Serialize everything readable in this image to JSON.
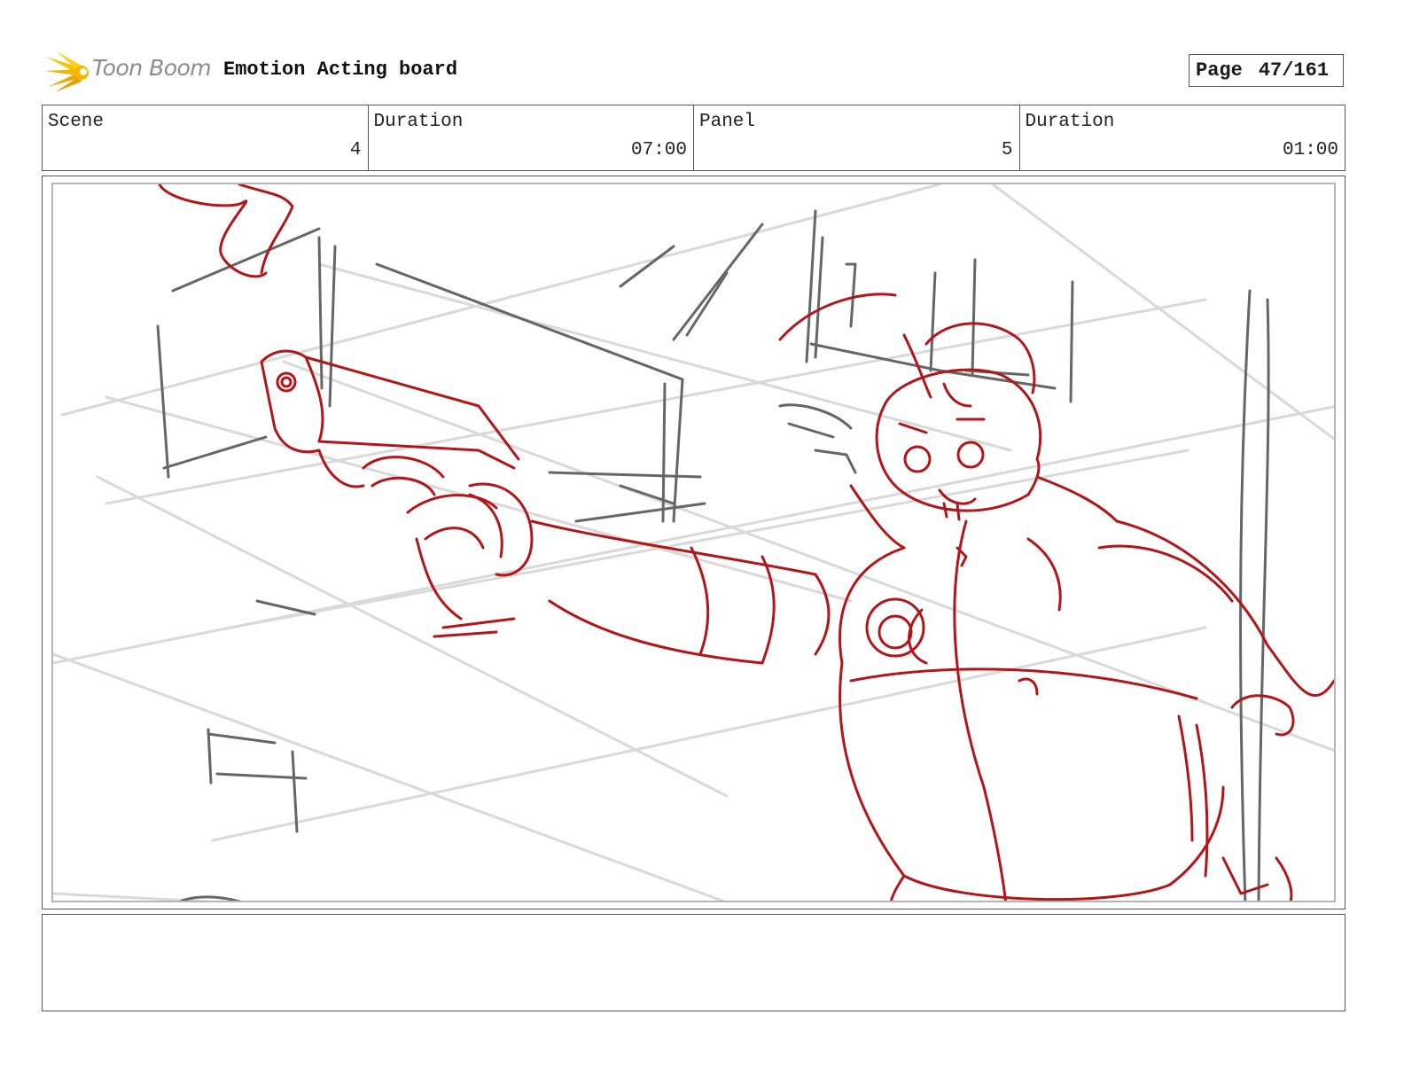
{
  "header": {
    "logo_text": "Toon Boom",
    "board_title": "Emotion Acting board",
    "page_label": "Page",
    "page_number": "47/161"
  },
  "info": {
    "scene_label": "Scene",
    "scene_value": "4",
    "scene_duration_label": "Duration",
    "scene_duration_value": "07:00",
    "panel_label": "Panel",
    "panel_value": "5",
    "panel_duration_label": "Duration",
    "panel_duration_value": "01:00"
  },
  "panel": {
    "image": "rough-sketch",
    "sketch_colors": {
      "character": "#b3161a",
      "background": "#666666",
      "guides": "#d9d9d9"
    }
  },
  "notes": {
    "text": ""
  },
  "colors": {
    "logo_accent": "#f5b800",
    "border": "#555555"
  }
}
